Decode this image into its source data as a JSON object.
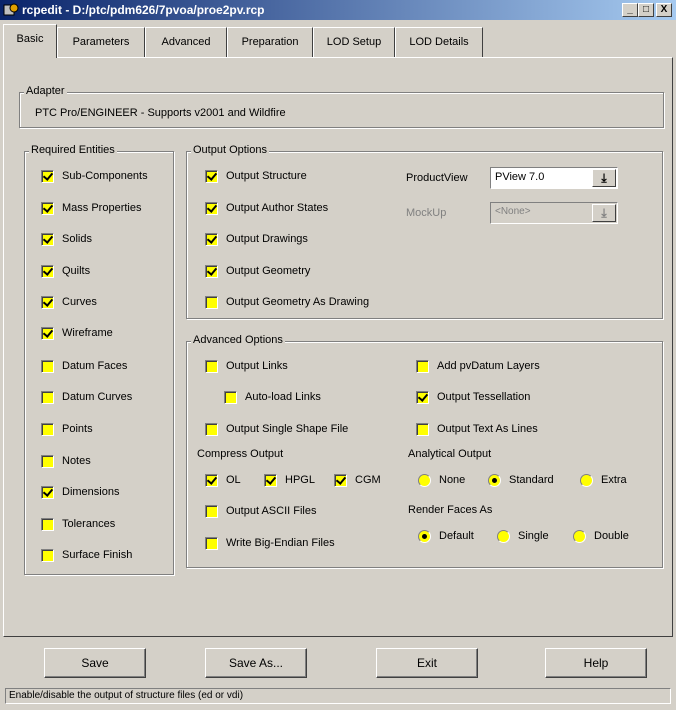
{
  "window": {
    "title": "rcpedit - D:/ptc/pdm626/7pvoa/proe2pv.rcp",
    "minimize": "_",
    "maximize": "□",
    "close": "X"
  },
  "tabs": [
    {
      "label": "Basic",
      "active": true
    },
    {
      "label": "Parameters",
      "active": false
    },
    {
      "label": "Advanced",
      "active": false
    },
    {
      "label": "Preparation",
      "active": false
    },
    {
      "label": "LOD Setup",
      "active": false
    },
    {
      "label": "LOD Details",
      "active": false
    }
  ],
  "adapter": {
    "legend": "Adapter",
    "text": "PTC Pro/ENGINEER  -  Supports v2001 and Wildfire"
  },
  "required_entities": {
    "legend": "Required Entities",
    "items": [
      {
        "label": "Sub-Components",
        "checked": true
      },
      {
        "label": "Mass Properties",
        "checked": true
      },
      {
        "label": "Solids",
        "checked": true
      },
      {
        "label": "Quilts",
        "checked": true
      },
      {
        "label": "Curves",
        "checked": true
      },
      {
        "label": "Wireframe",
        "checked": true
      },
      {
        "label": "Datum Faces",
        "checked": false
      },
      {
        "label": "Datum Curves",
        "checked": false
      },
      {
        "label": "Points",
        "checked": false
      },
      {
        "label": "Notes",
        "checked": false
      },
      {
        "label": "Dimensions",
        "checked": true
      },
      {
        "label": "Tolerances",
        "checked": false
      },
      {
        "label": "Surface Finish",
        "checked": false
      }
    ]
  },
  "output_options": {
    "legend": "Output Options",
    "items": [
      {
        "label": "Output Structure",
        "checked": true
      },
      {
        "label": "Output Author States",
        "checked": true
      },
      {
        "label": "Output Drawings",
        "checked": true
      },
      {
        "label": "Output Geometry",
        "checked": true
      },
      {
        "label": "Output Geometry As Drawing",
        "checked": false
      }
    ],
    "productview_label": "ProductView",
    "productview_value": "PView 7.0",
    "mockup_label": "MockUp",
    "mockup_value": "<None>"
  },
  "advanced_options": {
    "legend": "Advanced Options",
    "output_links": {
      "label": "Output Links",
      "checked": false
    },
    "auto_load_links": {
      "label": "Auto-load Links",
      "checked": false
    },
    "single_shape": {
      "label": "Output Single Shape File",
      "checked": false
    },
    "add_pvdatum": {
      "label": "Add pvDatum Layers",
      "checked": false
    },
    "tessellation": {
      "label": "Output Tessellation",
      "checked": true
    },
    "text_as_lines": {
      "label": "Output Text As Lines",
      "checked": false
    },
    "compress_label": "Compress Output",
    "compress": [
      {
        "label": "OL",
        "checked": true
      },
      {
        "label": "HPGL",
        "checked": true
      },
      {
        "label": "CGM",
        "checked": true
      }
    ],
    "ascii": {
      "label": "Output ASCII Files",
      "checked": false
    },
    "big_endian": {
      "label": "Write Big-Endian Files",
      "checked": false
    },
    "analytical_label": "Analytical Output",
    "analytical": [
      {
        "label": "None",
        "selected": false
      },
      {
        "label": "Standard",
        "selected": true
      },
      {
        "label": "Extra",
        "selected": false
      }
    ],
    "render_label": "Render Faces As",
    "render": [
      {
        "label": "Default",
        "selected": true
      },
      {
        "label": "Single",
        "selected": false
      },
      {
        "label": "Double",
        "selected": false
      }
    ]
  },
  "buttons": {
    "save": "Save",
    "save_as": "Save As...",
    "exit": "Exit",
    "help": "Help"
  },
  "status": "Enable/disable the output of structure files (ed or vdi)"
}
